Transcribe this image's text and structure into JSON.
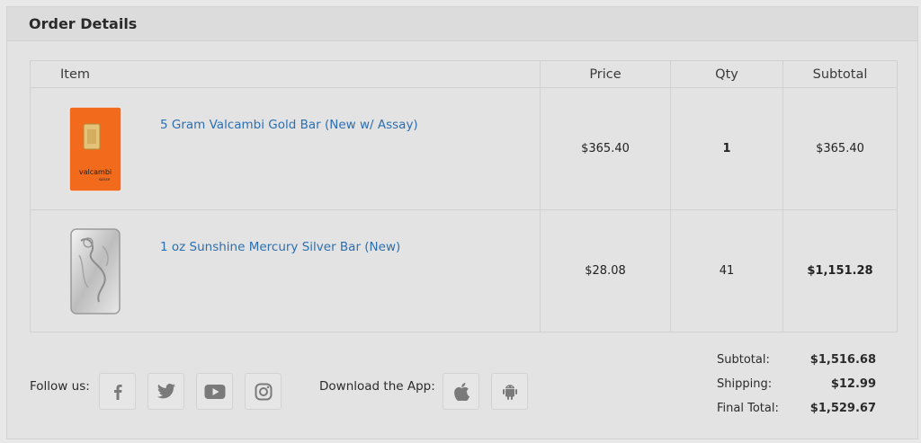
{
  "panel": {
    "title": "Order Details"
  },
  "table": {
    "headers": {
      "item": "Item",
      "price": "Price",
      "qty": "Qty",
      "subtotal": "Subtotal"
    },
    "rows": [
      {
        "name": "5 Gram Valcambi Gold Bar (New w/ Assay)",
        "price": "$365.40",
        "qty": "1",
        "subtotal": "$365.40",
        "thumb_label": "valcambi",
        "thumb_sub": "suisse"
      },
      {
        "name": "1 oz Sunshine Mercury Silver Bar (New)",
        "price": "$28.08",
        "qty": "41",
        "subtotal": "$1,151.28"
      }
    ]
  },
  "footer": {
    "follow_label": "Follow us:",
    "social_icons": [
      "facebook-icon",
      "twitter-icon",
      "youtube-icon",
      "instagram-icon"
    ],
    "download_label": "Download the App:",
    "app_icons": [
      "apple-icon",
      "android-icon"
    ]
  },
  "totals": {
    "subtotal_label": "Subtotal:",
    "subtotal_value": "$1,516.68",
    "shipping_label": "Shipping:",
    "shipping_value": "$12.99",
    "final_label": "Final Total:",
    "final_value": "$1,529.67"
  },
  "colors": {
    "link": "#2d6fb0",
    "gold_card": "#f26a1b",
    "icon": "#7a7a7a"
  }
}
